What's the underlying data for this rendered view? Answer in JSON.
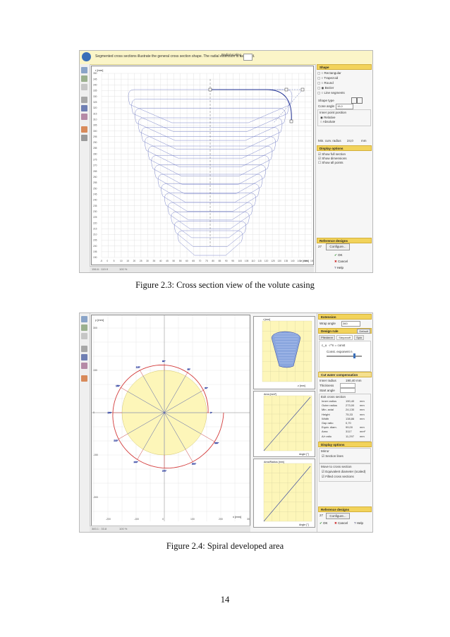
{
  "figure1": {
    "caption": "Figure 2.3: Cross section view of the volute casing",
    "message": "Segmented cross sections illustrate the general cross section shape. The radial extension is assumed.",
    "spinner_label": "Radial scaling",
    "y_axis_label": "r [mm]",
    "x_axis_label": "z [mm]",
    "y_ticks": [
      "350",
      "345",
      "340",
      "335",
      "330",
      "325",
      "320",
      "315",
      "310",
      "305",
      "300",
      "295",
      "290",
      "285",
      "280",
      "275",
      "270",
      "265",
      "260",
      "255",
      "250",
      "245",
      "240",
      "235",
      "230",
      "225",
      "220",
      "215",
      "210",
      "205",
      "200",
      "195",
      "190"
    ],
    "x_ticks": [
      "-5",
      "0",
      "5",
      "10",
      "15",
      "20",
      "25",
      "30",
      "35",
      "40",
      "45",
      "50",
      "55",
      "60",
      "65",
      "70",
      "75",
      "80",
      "85",
      "90",
      "95",
      "100",
      "105",
      "110",
      "115",
      "120",
      "125",
      "130",
      "135",
      "140",
      "145",
      "150",
      "155"
    ],
    "status": [
      "156.6 : 119.9",
      "100 %"
    ],
    "shape_header": "Shape",
    "shape_options": [
      "Rectangular",
      "Trapezoid",
      "Round",
      "Bezier",
      "Line segments"
    ],
    "shape_type_label": "Shape type",
    "cone_angle_label": "Cone angle",
    "cone_angle_value": "15,0",
    "inner_point_label": "Inner point position",
    "inner_point_options": [
      "Relative",
      "Absolute"
    ],
    "min_curv_label": "Min. curv. radius",
    "min_curv_value": "24,0",
    "min_curv_unit": "mm",
    "display_header": "Display options",
    "display_options": [
      "Show full section",
      "Show dimensions",
      "Show all points"
    ],
    "ref_header": "Reference designs",
    "ref_value": "27",
    "configure_label": "Configure...",
    "buttons": [
      "OK",
      "Cancel",
      "Help"
    ]
  },
  "figure2": {
    "caption": "Figure 2.4: Spiral developed area",
    "y_axis_label": "y [mm]",
    "x_axis_label": "x [mm]",
    "y_ticks": [
      "450",
      "300",
      "150",
      "0",
      "-150",
      "-300",
      "-450"
    ],
    "x_ticks": [
      "-300",
      "-200",
      "-100",
      "0",
      "100",
      "200",
      "300"
    ],
    "spokes": [
      "0°",
      "30°",
      "60°",
      "90°",
      "120°",
      "150°",
      "180°",
      "210°",
      "240°",
      "270°",
      "300°",
      "330°"
    ],
    "status": [
      "383.1 : 33.8",
      "100 %"
    ],
    "mini1_label": "r [mm]",
    "mini1_x": "z [mm]",
    "mini2_label": "Area [mm²]",
    "mini2_x": "Angle [°]",
    "mini3_label": "Area/Radius [mm]",
    "mini3_x": "Angle [°]",
    "extension_header": "Extension",
    "wrap_angle_label": "Wrap angle",
    "wrap_angle_value": "360",
    "design_rule_header": "Design rule",
    "default_label": "Default",
    "tabs": [
      "Pfleiderer",
      "Stepanoff",
      "Spin"
    ],
    "formula": "c_u · r^n = const",
    "const_label": "Const. exponent n",
    "cut_water_header": "Cut water compensation",
    "inner_radius_label": "Inner radius",
    "inner_radius_value": "190,40 mm",
    "thickness_label": "Thickness",
    "start_angle_label": "Start angle",
    "exit_section_label": "Exit cross section",
    "exit_rows": [
      [
        "Inner radius",
        "190,40",
        "mm"
      ],
      [
        "Outer radius",
        "273,00",
        "mm"
      ],
      [
        "Min. axial",
        "24,130",
        "mm"
      ],
      [
        "Height",
        "75,33",
        "mm"
      ],
      [
        "Width",
        "138,86",
        "mm"
      ],
      [
        "Gap ratio",
        "0,70",
        ""
      ],
      [
        "Equiv. diam.",
        "99,00",
        "mm"
      ],
      [
        "Area",
        "3117",
        "mm²"
      ],
      [
        "A/r ratio",
        "11,297",
        "mm"
      ]
    ],
    "display_header": "Display options",
    "mirror_label": "Mirror",
    "section_lines_label": "Section lines",
    "move_header": "Move to cross section",
    "move_options": [
      "Equivalent diameter (scaled)",
      "Filled cross sections"
    ],
    "ref_header": "Reference designs",
    "ref_value": "27",
    "configure_label": "Configure...",
    "buttons": [
      "OK",
      "Cancel",
      "Help"
    ]
  },
  "page_number": "14",
  "colors": {
    "accent": "#f2d35b",
    "plot_blue": "#2e3f9e",
    "spiral_red": "#d33a3a",
    "fill_yellow": "#fdf6b9"
  }
}
